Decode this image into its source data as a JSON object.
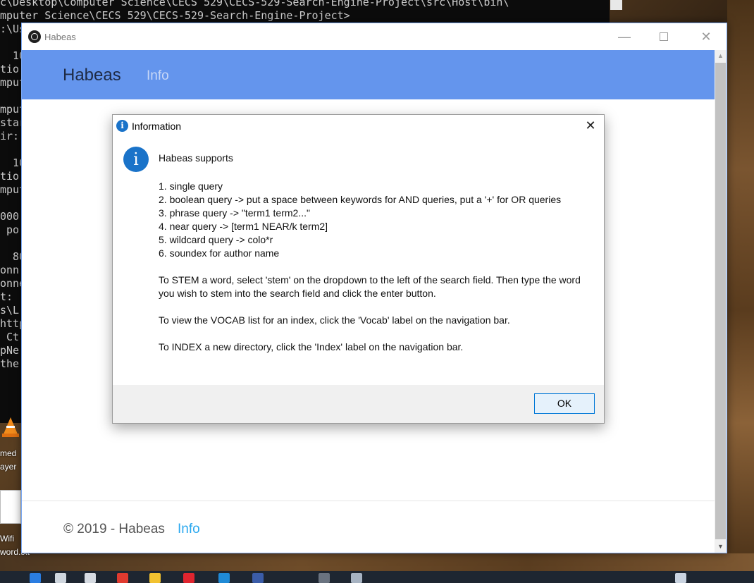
{
  "console": {
    "lines": [
      "c\\Desktop\\Computer Science\\CECS 529\\CECS-529-Search-Engine-Project\\src\\Host\\bin\\",
      "mputer Science\\CECS 529\\CECS-529-Search-Engine-Project>",
      ":\\Users\\Lenovo\\Desktop\\Computer Science\\CECS 529\\CECS-529-Search-Engine-Project\\obj\\Host\\node",
      "",
      "  10",
      "tio",
      "mput",
      "",
      "mput",
      "star",
      "ir:",
      "",
      "  10",
      "tio",
      "mput",
      "",
      "000",
      " po",
      "",
      "  80",
      "onn",
      "onne",
      "t: ",
      "s\\L",
      "http",
      " Ct",
      "pNe",
      "the"
    ]
  },
  "desktop": {
    "icon1_label_a": "med",
    "icon1_label_b": "ayer",
    "icon2_label_a": "Wifi",
    "icon2_label_b": "word.txt"
  },
  "window": {
    "title": "Habeas",
    "minimize_glyph": "—",
    "close_glyph": "✕"
  },
  "navbar": {
    "brand": "Habeas",
    "info_link": "Info"
  },
  "footer": {
    "copyright": "© 2019 - Habeas",
    "info_link": "Info"
  },
  "dialog": {
    "title": "Information",
    "icon_glyph": "i",
    "close_glyph": "✕",
    "heading": "Habeas supports",
    "items": [
      "1. single query",
      "2. boolean query -> put a space between keywords for AND queries, put a '+' for OR queries",
      "3. phrase query -> \"term1 term2...\"",
      "4. near query -> [term1 NEAR/k term2]",
      "5. wildcard query -> colo*r",
      "6. soundex for author name"
    ],
    "stem_text": "To STEM a word, select 'stem' on the dropdown to the left of the search field. Then type the word you wish to stem into the search field and click the enter button.",
    "vocab_text": "To view the VOCAB list for an index, click the 'Vocab' label on the navigation bar.",
    "index_text": "To INDEX a new directory, click the 'Index' label on the navigation bar.",
    "ok_label": "OK"
  },
  "colors": {
    "navbar": "#6495ed",
    "footer_link": "#2aa8ef",
    "info_icon": "#1a73c9"
  }
}
